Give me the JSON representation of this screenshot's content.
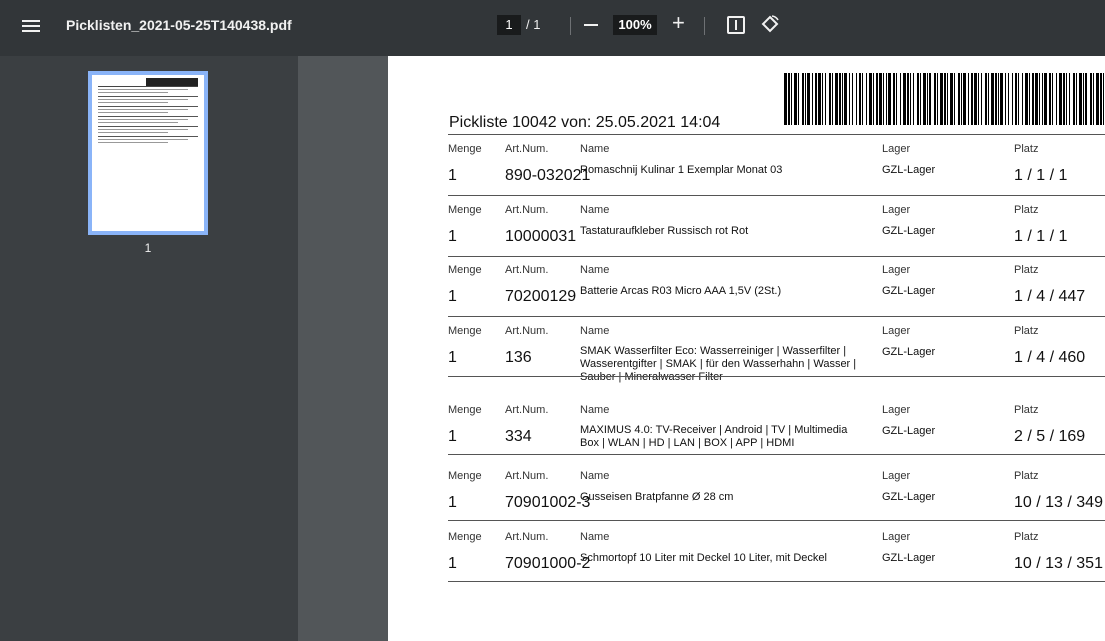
{
  "toolbar": {
    "file_name": "Picklisten_2021-05-25T140438.pdf",
    "current_page": "1",
    "page_total": "/ 1",
    "zoom": "100%"
  },
  "sidebar": {
    "thumbnail_label": "1"
  },
  "document": {
    "title": "Pickliste 10042 von: 25.05.2021 14:04",
    "labels": {
      "qty": "Menge",
      "artnum": "Art.Num.",
      "name": "Name",
      "lager": "Lager",
      "platz": "Platz"
    },
    "rows": [
      {
        "qty": "1",
        "artnum": "890-032021",
        "name": "Romaschnij Kulinar 1 Exemplar Monat 03",
        "lager": "GZL-Lager",
        "platz": "1 / 1 / 1"
      },
      {
        "qty": "1",
        "artnum": "10000031",
        "name": "Tastaturaufkleber Russisch rot Rot",
        "lager": "GZL-Lager",
        "platz": "1 / 1 / 1"
      },
      {
        "qty": "1",
        "artnum": "70200129",
        "name": "Batterie Arcas R03 Micro AAA 1,5V (2St.)",
        "lager": "GZL-Lager",
        "platz": "1 / 4 / 447"
      },
      {
        "qty": "1",
        "artnum": "136",
        "name": "SMAK Wasserfilter Eco: Wasserreiniger | Wasserfilter | Wasserentgifter | SMAK | für den Wasserhahn | Wasser | Sauber | Mineralwasser Filter",
        "lager": "GZL-Lager",
        "platz": "1 / 4 / 460"
      },
      {
        "qty": "1",
        "artnum": "334",
        "name": "MAXIMUS 4.0: TV-Receiver | Android | TV | Multimedia Box | WLAN | HD | LAN | BOX | APP | HDMI",
        "lager": "GZL-Lager",
        "platz": "2 / 5 / 169"
      },
      {
        "qty": "1",
        "artnum": "70901002-3",
        "name": "Gusseisen Bratpfanne Ø 28 cm",
        "lager": "GZL-Lager",
        "platz": "10 / 13 / 349"
      },
      {
        "qty": "1",
        "artnum": "70901000-2",
        "name": "Schmortopf 10 Liter mit Deckel 10 Liter, mit Deckel",
        "lager": "GZL-Lager",
        "platz": "10 / 13 / 351"
      }
    ]
  }
}
